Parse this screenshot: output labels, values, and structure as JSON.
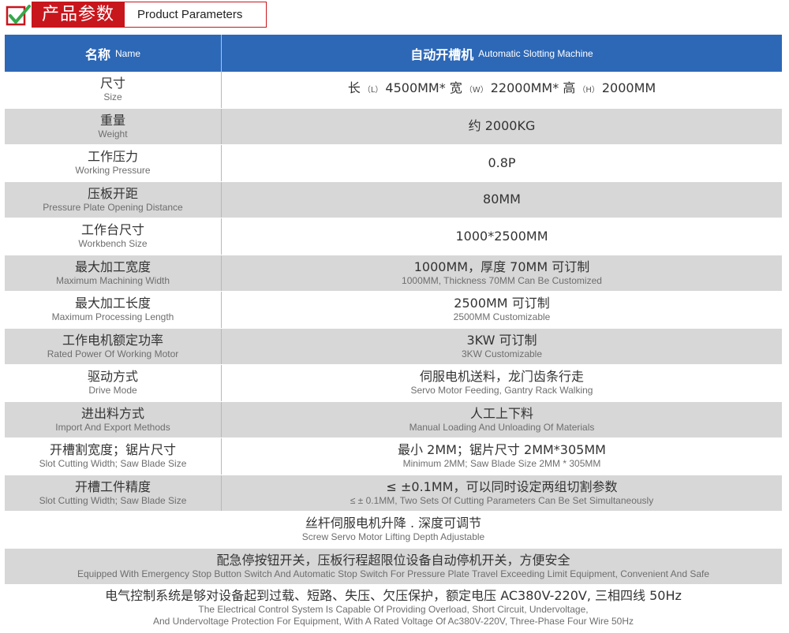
{
  "header": {
    "title_zh": "产品参数",
    "title_en": "Product Parameters"
  },
  "table": {
    "head": {
      "left_zh": "名称",
      "left_en": "Name",
      "right_zh": "自动开槽机",
      "right_en": "Automatic Slotting Machine"
    },
    "size": {
      "label_zh": "尺寸",
      "label_en": "Size",
      "p1": "长",
      "u1": "（L）",
      "p2": "4500MM* 宽",
      "u2": "（W）",
      "p3": "22000MM* 高",
      "u3": "（H）",
      "p4": "2000MM"
    },
    "rows": [
      {
        "label_zh": "重量",
        "label_en": "Weight",
        "value_zh": "约 2000KG",
        "value_en": ""
      },
      {
        "label_zh": "工作压力",
        "label_en": "Working Pressure",
        "value_zh": "0.8P",
        "value_en": ""
      },
      {
        "label_zh": "压板开距",
        "label_en": "Pressure Plate Opening Distance",
        "value_zh": "80MM",
        "value_en": ""
      },
      {
        "label_zh": "工作台尺寸",
        "label_en": "Workbench Size",
        "value_zh": "1000*2500MM",
        "value_en": ""
      },
      {
        "label_zh": "最大加工宽度",
        "label_en": "Maximum Machining Width",
        "value_zh": "1000MM，厚度 70MM 可订制",
        "value_en": "1000MM, Thickness 70MM Can Be Customized"
      },
      {
        "label_zh": "最大加工长度",
        "label_en": "Maximum Processing Length",
        "value_zh": "2500MM 可订制",
        "value_en": "2500MM Customizable"
      },
      {
        "label_zh": "工作电机额定功率",
        "label_en": "Rated Power Of Working Motor",
        "value_zh": "3KW 可订制",
        "value_en": "3KW Customizable"
      },
      {
        "label_zh": "驱动方式",
        "label_en": "Drive Mode",
        "value_zh": "伺服电机送料，龙门齿条行走",
        "value_en": "Servo Motor Feeding, Gantry Rack Walking"
      },
      {
        "label_zh": "进出料方式",
        "label_en": "Import And Export Methods",
        "value_zh": "人工上下料",
        "value_en": "Manual Loading And Unloading Of Materials"
      },
      {
        "label_zh": "开槽割宽度；锯片尺寸",
        "label_en": "Slot Cutting Width; Saw Blade Size",
        "value_zh": "最小 2MM；锯片尺寸 2MM*305MM",
        "value_en": "Minimum 2MM; Saw Blade Size 2MM * 305MM"
      },
      {
        "label_zh": "开槽工件精度",
        "label_en": "Slot Cutting Width; Saw Blade Size",
        "value_zh": "≤ ±0.1MM，可以同时设定两组切割参数",
        "value_en": "≤ ± 0.1MM, Two Sets Of Cutting Parameters Can Be Set Simultaneously"
      }
    ],
    "full_rows": [
      {
        "zh": "丝杆伺服电机升降 . 深度可调节",
        "en": "Screw Servo Motor Lifting Depth Adjustable",
        "en2": ""
      },
      {
        "zh": "配急停按钮开关，压板行程超限位设备自动停机开关，方便安全",
        "en": "Equipped With Emergency Stop Button Switch And Automatic Stop Switch For Pressure Plate Travel Exceeding Limit Equipment, Convenient And Safe",
        "en2": ""
      },
      {
        "zh": "电气控制系统是够对设备起到过载、短路、失压、欠压保护，额定电压 AC380V-220V, 三相四线 50Hz",
        "en": "The Electrical Control System Is Capable Of Providing Overload, Short Circuit, Undervoltage,",
        "en2": "And Undervoltage Protection For Equipment, With A Rated Voltage Of Ac380V-220V, Three-Phase Four Wire 50Hz"
      }
    ]
  },
  "colors": {
    "brand_red": "#c8161d",
    "header_blue": "#2d68b7",
    "stripe_gray": "#d7d7d7"
  },
  "icons": {
    "logo": "checkmark-badge-icon"
  }
}
